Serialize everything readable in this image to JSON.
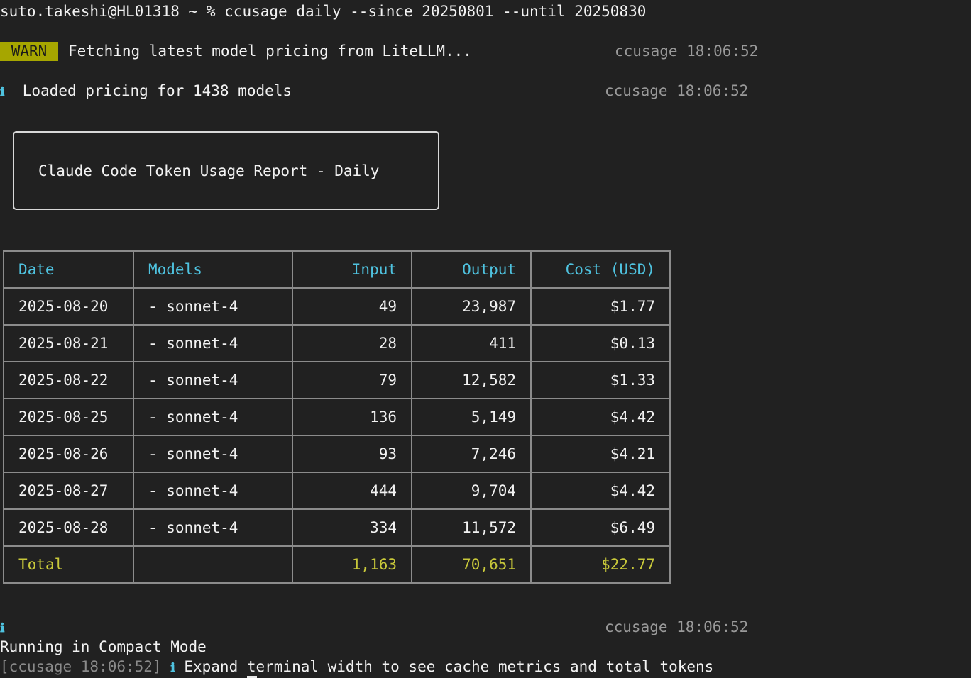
{
  "prompt": {
    "user_host": "suto.takeshi@HL01318",
    "cwd": "~",
    "symbol": "%",
    "command": "ccusage daily --since 20250801 --until 20250830"
  },
  "log": {
    "warn_badge": "WARN",
    "warn_message": "Fetching latest model pricing from LiteLLM...",
    "warn_timestamp": "ccusage 18:06:52",
    "info_icon": "ℹ",
    "info_message": "Loaded pricing for 1438 models",
    "info_timestamp": "ccusage 18:06:52",
    "info2_timestamp": "ccusage 18:06:52",
    "compact_message": "Running in Compact Mode",
    "bracket_timestamp": "[ccusage 18:06:52]",
    "expand_message": "Expand terminal width to see cache metrics and total tokens"
  },
  "report": {
    "title": "Claude Code Token Usage Report - Daily"
  },
  "table": {
    "headers": [
      "Date",
      "Models",
      "Input",
      "Output",
      "Cost (USD)"
    ],
    "rows": [
      {
        "date": "2025-08-20",
        "models": "- sonnet-4",
        "input": "49",
        "output": "23,987",
        "cost": "$1.77"
      },
      {
        "date": "2025-08-21",
        "models": "- sonnet-4",
        "input": "28",
        "output": "411",
        "cost": "$0.13"
      },
      {
        "date": "2025-08-22",
        "models": "- sonnet-4",
        "input": "79",
        "output": "12,582",
        "cost": "$1.33"
      },
      {
        "date": "2025-08-25",
        "models": "- sonnet-4",
        "input": "136",
        "output": "5,149",
        "cost": "$4.42"
      },
      {
        "date": "2025-08-26",
        "models": "- sonnet-4",
        "input": "93",
        "output": "7,246",
        "cost": "$4.21"
      },
      {
        "date": "2025-08-27",
        "models": "- sonnet-4",
        "input": "444",
        "output": "9,704",
        "cost": "$4.42"
      },
      {
        "date": "2025-08-28",
        "models": "- sonnet-4",
        "input": "334",
        "output": "11,572",
        "cost": "$6.49"
      }
    ],
    "total": {
      "label": "Total",
      "models": "",
      "input": "1,163",
      "output": "70,651",
      "cost": "$22.77"
    }
  },
  "colors": {
    "background": "#212121",
    "text": "#f2f2f2",
    "header_cyan": "#4fc3e0",
    "total_yellow": "#c8c83a",
    "warn_badge": "#a6a600",
    "timestamp_gray": "#9a9a9a"
  }
}
